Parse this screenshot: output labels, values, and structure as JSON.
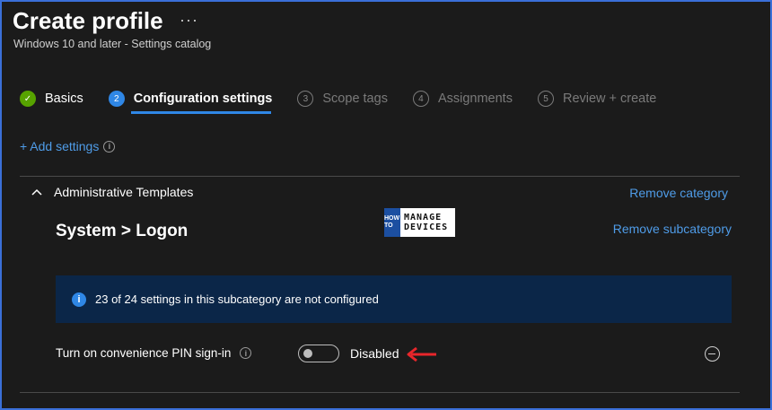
{
  "header": {
    "title": "Create profile",
    "subtitle": "Windows 10 and later - Settings catalog",
    "more_label": "···"
  },
  "steps": [
    {
      "number": "✓",
      "label": "Basics",
      "state": "done"
    },
    {
      "number": "2",
      "label": "Configuration settings",
      "state": "active"
    },
    {
      "number": "3",
      "label": "Scope tags",
      "state": "pending"
    },
    {
      "number": "4",
      "label": "Assignments",
      "state": "pending"
    },
    {
      "number": "5",
      "label": "Review + create",
      "state": "pending"
    }
  ],
  "add_settings": {
    "label": "+ Add settings",
    "info_icon": "i"
  },
  "category": {
    "name": "Administrative Templates",
    "remove_label": "Remove category"
  },
  "subcategory": {
    "name": "System > Logon",
    "remove_label": "Remove subcategory"
  },
  "watermark": {
    "howto": "HOW TO",
    "brand_line1": "MANAGE",
    "brand_line2": "DEVICES"
  },
  "banner": {
    "icon": "i",
    "text": "23 of 24 settings in this subcategory are not configured"
  },
  "setting": {
    "name": "Turn on convenience PIN sign-in",
    "info_icon": "i",
    "toggle_state": "Disabled",
    "toggle_on": false
  },
  "colors": {
    "accent": "#2f87e6",
    "link": "#4f9ce8",
    "success": "#57a300",
    "banner_bg": "#0b2648",
    "arrow": "#e8262b"
  },
  "icons": [
    "more-icon",
    "check-icon",
    "chevron-up-icon",
    "info-icon",
    "remove-circle-icon",
    "red-arrow-icon"
  ]
}
